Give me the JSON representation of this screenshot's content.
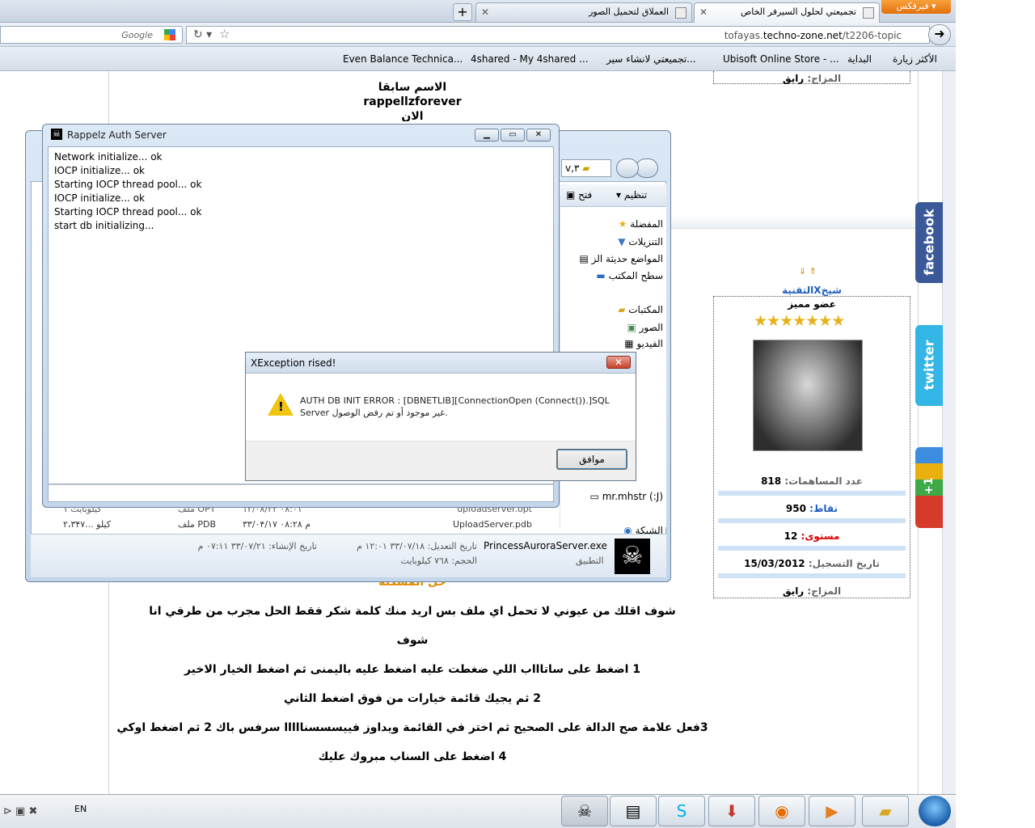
{
  "browser": {
    "ff_button": "فيرفكس",
    "tabs": [
      {
        "label": "تجميعتي لحلول السيرفر الخاص",
        "active": true
      },
      {
        "label": "العملاق لتحميل الصور",
        "active": false
      }
    ],
    "new_tab": "+",
    "search_placeholder": "Google",
    "url_prefix": "tofayas.",
    "url_domain": "techno-zone.net",
    "url_path": "/t2206-topic",
    "bookmarks": [
      "الأكثر زيارة",
      "البداية",
      "Ubisoft Online Store - ...",
      "تجميعتي لانشاء سير...",
      "4shared - My 4shared ...",
      "Even Balance Technica..."
    ]
  },
  "page": {
    "post_lines": [
      "الاسم سابقا",
      "rappellzforever",
      "الان"
    ],
    "arrows": "⇓ ⇑",
    "profile_name": "شيخXالتقنية",
    "rank": "عضو مميز",
    "stars": "★★★★★★★",
    "mood_top_label": "المزاج:",
    "mood_top_value": "رايق",
    "stats": [
      {
        "label": "عدد المساهمات:",
        "value": "818",
        "color": "#666"
      },
      {
        "label": "نقاط:",
        "value": "950",
        "color": "#1f5fbf"
      },
      {
        "label": "مستوى:",
        "value": "12",
        "color": "#d00"
      },
      {
        "label": "تاريخ التسجيل:",
        "value": "15/03/2012",
        "color": "#666"
      },
      {
        "label": "المزاج:",
        "value": "رايق",
        "color": "#666"
      }
    ],
    "heading_partial": "حل المشكلة",
    "body": [
      "شوف اقلك من عيوني لا تحمل اي ملف بس اريد منك كلمة شكر فقط الحل مجرب من طرفي انا",
      "شوف",
      "1 اضغط على ساتاااب اللي ضغطت عليه اضغط عليه باليمنى ثم اضغط الخيار الاخير",
      "2 ثم يجيك قائمة خيارات من فوق اضغط الثاني",
      "3فعل علامة صح الدالة على الصحيح ثم اختر في القائمة ويداوز فييسسسنااااا سرفس باك 2 ثم اضغط اوكي",
      "4 اضغط على السناب مبروك عليك"
    ],
    "social": [
      "facebook",
      "twitter",
      "+1"
    ]
  },
  "explorer": {
    "path": "v,٣",
    "organize": "تنظيم",
    "open": "فتح",
    "nav": [
      "المفضلة",
      "التنزيلات",
      "المواضع حديثة الز",
      "سطح المكتب",
      "المكتبات",
      "الصور",
      "الفيديو",
      "(J:) mr.mhstr",
      "الشبكة"
    ],
    "files": [
      {
        "name": "uploadserver.opt",
        "date": "۱۲/۰۸/۳۳ ۰۸:۰۱",
        "type": "ملف OPT",
        "size": "۱ كيلوبايت"
      },
      {
        "name": "UploadServer.pdb",
        "date": "۳۳/۰۴/۱۷ م ۰۸:۲۸",
        "type": "ملف PDB",
        "size": "۲،۳۴۷... كيلو"
      }
    ],
    "selected_name": "PrincessAuroraServer.exe",
    "selected_kind": "التطبيق",
    "modified": "تاريخ التعديل: ٣٣/٠٧/١٨ ١٢:٠١ م",
    "size": "الحجم: ٧٦٨ كيلوبايت",
    "created": "تاريخ الإنشاء: ٣٣/٠٧/٢١ ٠٧:١١ م"
  },
  "console": {
    "title": "Rappelz Auth Server",
    "lines": [
      "Network initialize...   ok",
      "IOCP initialize...   ok",
      "Starting IOCP thread pool...   ok",
      "IOCP initialize...   ok",
      "Starting IOCP thread pool...   ok",
      "start db initializing..."
    ]
  },
  "dialog": {
    "title": "XException rised!",
    "message_1": "AUTH DB INIT ERROR : [DBNETLIB][ConnectionOpen (Connect()).]SQL",
    "message_2": "Server غير موجود أو تم رفض الوصول.",
    "ok": "موافق"
  },
  "taskbar": {
    "lang": "EN"
  }
}
